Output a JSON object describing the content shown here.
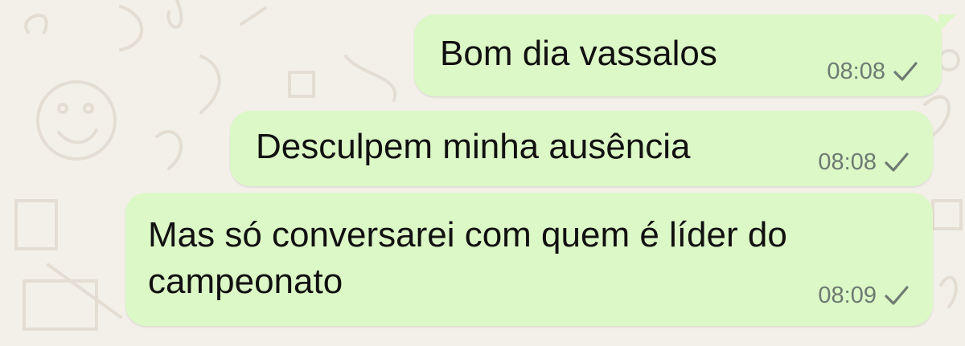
{
  "conversation": {
    "messages": [
      {
        "text": "Bom dia vassalos",
        "time": "08:08",
        "status_icon": "single-check-icon"
      },
      {
        "text": "Desculpem minha ausência",
        "time": "08:08",
        "status_icon": "single-check-icon"
      },
      {
        "text_line1": "Mas só conversarei com quem é líder do",
        "text_line2": "campeonato",
        "time": "08:09",
        "status_icon": "single-check-icon"
      }
    ]
  },
  "colors": {
    "background": "#f3efe9",
    "bubble_outgoing": "#dcf8c6",
    "message_text": "#111111",
    "timestamp_text": "#6e7a72"
  }
}
